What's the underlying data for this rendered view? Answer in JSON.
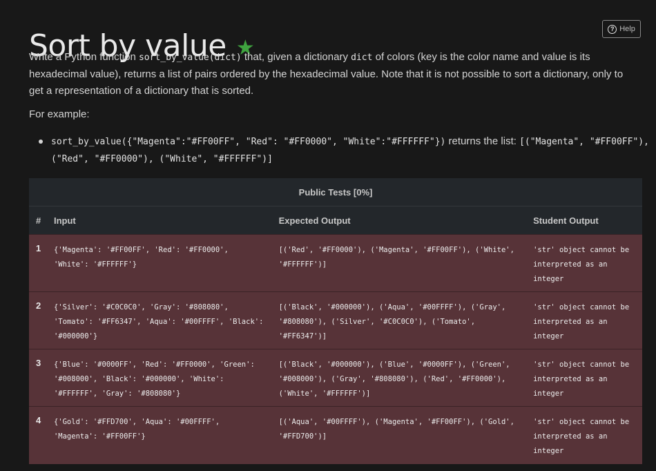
{
  "header": {
    "title": "Sort by value",
    "star": "★",
    "help_label": "Help",
    "help_icon_glyph": "?"
  },
  "description": {
    "part1": "Write a Python function ",
    "code1": "sort_by_value(dict)",
    "part2": " that, given a dictionary ",
    "code2": "dict",
    "part3": " of colors (key is the color name and value is its hexadecimal value), returns a list of pairs ordered by the hexadecimal value. Note that it is not possible to sort a dictionary, only to get a representation of a dictionary that is sorted."
  },
  "example": {
    "heading": "For example:",
    "code_call": "sort_by_value({\"Magenta\":\"#FF00FF\", \"Red\": \"#FF0000\", \"White\":\"#FFFFFF\"})",
    "text": " returns the list: ",
    "code_result": "[(\"Magenta\", \"#FF00FF\"), (\"Red\", \"#FF0000\"), (\"White\", \"#FFFFFF\")]"
  },
  "tests": {
    "caption": "Public Tests [0%]",
    "columns": {
      "num": "#",
      "input": "Input",
      "expected": "Expected Output",
      "student": "Student Output"
    },
    "rows": [
      {
        "num": "1",
        "input": "{'Magenta': '#FF00FF', 'Red': '#FF0000', 'White': '#FFFFFF'}",
        "expected": "[('Red', '#FF0000'), ('Magenta', '#FF00FF'), ('White', '#FFFFFF')]",
        "student": "'str' object cannot be interpreted as an integer"
      },
      {
        "num": "2",
        "input": "{'Silver': '#C0C0C0', 'Gray': '#808080', 'Tomato': '#FF6347', 'Aqua': '#00FFFF', 'Black': '#000000'}",
        "expected": "[('Black', '#000000'), ('Aqua', '#00FFFF'), ('Gray', '#808080'), ('Silver', '#C0C0C0'), ('Tomato', '#FF6347')]",
        "student": "'str' object cannot be interpreted as an integer"
      },
      {
        "num": "3",
        "input": "{'Blue': '#0000FF', 'Red': '#FF0000', 'Green': '#008000', 'Black': '#000000', 'White': '#FFFFFF', 'Gray': '#808080'}",
        "expected": "[('Black', '#000000'), ('Blue', '#0000FF'), ('Green', '#008000'), ('Gray', '#808080'), ('Red', '#FF0000'), ('White', '#FFFFFF')]",
        "student": "'str' object cannot be interpreted as an integer"
      },
      {
        "num": "4",
        "input": "{'Gold': '#FFD700', 'Aqua': '#00FFFF', 'Magenta': '#FF00FF'}",
        "expected": "[('Aqua', '#00FFFF'), ('Magenta', '#FF00FF'), ('Gold', '#FFD700')]",
        "student": "'str' object cannot be interpreted as an integer"
      }
    ]
  },
  "colors": {
    "background": "#181818",
    "star": "#3fa33f",
    "failed_row": "#573338",
    "table_header": "#23272b"
  }
}
